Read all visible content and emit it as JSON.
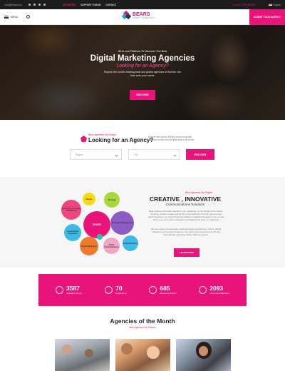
{
  "topbar": {
    "email": "Your@Email.com",
    "links": [
      "ADVERTISE",
      "SUPPORT FORUM",
      "CONTACT"
    ],
    "login": "LOGIN / JOIN BEARS",
    "language": "English"
  },
  "nav": {
    "menu_label": "MENU",
    "brand": "BEARS",
    "tagline": "AGENCY DIRECTORY",
    "submit_label": "SUBMIT YOUR AGENCY"
  },
  "hero": {
    "pre": "All-in-one Platform To Discover The Best",
    "title": "Digital Marketing Agencies",
    "subtitle": "Looking for an Agency?",
    "description": "Explore the world's leading local and global agencies to find the one that suits your needs",
    "button": "DISCOVER"
  },
  "find": {
    "kicker": "Best Agencies By Region",
    "title": "Looking for an Agency?",
    "description": "Explore the world's leading local and global agencies to find the one that suits your needs",
    "region_placeholder": "Region",
    "city_placeholder": "City",
    "button": "FIND NOW"
  },
  "about": {
    "kicker": "Best Agencies By Region",
    "title": "CREATIVE , INNOVATIVE",
    "subtitle": "Communications Solutions",
    "para1": "Bears defines the public reaction to our marketing, on the behalf of our clients, handling, content, media, and all the communications that can give the best reach towards to our clients that may publish on behalf of its agency. It's a portal that's very much about strategies and digital world wide on marketing.",
    "para2": "We are a team of passionate media strategies practitioners, writers, digital marketers and creative designers. Our clients are big and small, UK and International, spanning, listing, different sectors.",
    "button": "LEARN MORE",
    "center_bubble": "BEARS",
    "bubbles": [
      "Design",
      "Strategy",
      "Consulting & Contact & Marketing",
      "Social Media Integration",
      "Placement Management",
      "Digital Marketing",
      "Brand Communications",
      "Public Relations"
    ]
  },
  "stats": [
    {
      "number": "3587",
      "label": "Satisfied Clients"
    },
    {
      "number": "70",
      "label": "Employees"
    },
    {
      "number": "685",
      "label": "Business Posted"
    },
    {
      "number": "2093",
      "label": "Dedicated Members"
    }
  ],
  "month": {
    "title": "Agencies of the Month",
    "kicker": "Best Agencies By Region"
  },
  "colors": {
    "accent": "#e8147a",
    "dark": "#1c1c1c"
  }
}
